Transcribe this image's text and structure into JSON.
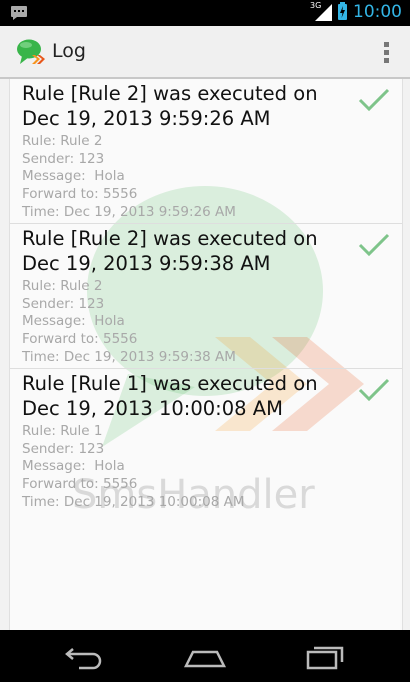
{
  "status_bar": {
    "network_type": "3G",
    "time": "10:00",
    "icons": [
      "notification-icon",
      "signal-icon",
      "battery-icon"
    ]
  },
  "action_bar": {
    "title": "Log",
    "icons": [
      "app-logo-icon",
      "overflow-menu-icon"
    ]
  },
  "watermark": {
    "text": "SmsHandler"
  },
  "log_items": [
    {
      "title": "Rule [Rule 2] was executed on Dec 19, 2013 9:59:26 AM",
      "rule": "Rule: Rule 2",
      "sender": "Sender: 123",
      "message": "Message:  Hola",
      "forward_to": "Forward to: 5556",
      "time": "Time: Dec 19, 2013 9:59:26 AM",
      "status_icon": "check-icon",
      "status_color": "#7ec48a"
    },
    {
      "title": "Rule [Rule 2] was executed on Dec 19, 2013 9:59:38 AM",
      "rule": "Rule: Rule 2",
      "sender": "Sender: 123",
      "message": "Message:  Hola",
      "forward_to": "Forward to: 5556",
      "time": "Time: Dec 19, 2013 9:59:38 AM",
      "status_icon": "check-icon",
      "status_color": "#7ec48a"
    },
    {
      "title": "Rule [Rule 1] was executed on Dec 19, 2013 10:00:08 AM",
      "rule": "Rule: Rule 1",
      "sender": "Sender: 123",
      "message": "Message:  Hola",
      "forward_to": "Forward to: 5556",
      "time": "Time: Dec 19, 2013 10:00:08 AM",
      "status_icon": "check-icon",
      "status_color": "#7ec48a"
    }
  ],
  "nav_bar": {
    "icons": [
      "back-icon",
      "home-icon",
      "recent-apps-icon"
    ]
  },
  "colors": {
    "accent": "#33b5e5",
    "logo_green": "#39b54a",
    "logo_orange": "#f7941d"
  }
}
